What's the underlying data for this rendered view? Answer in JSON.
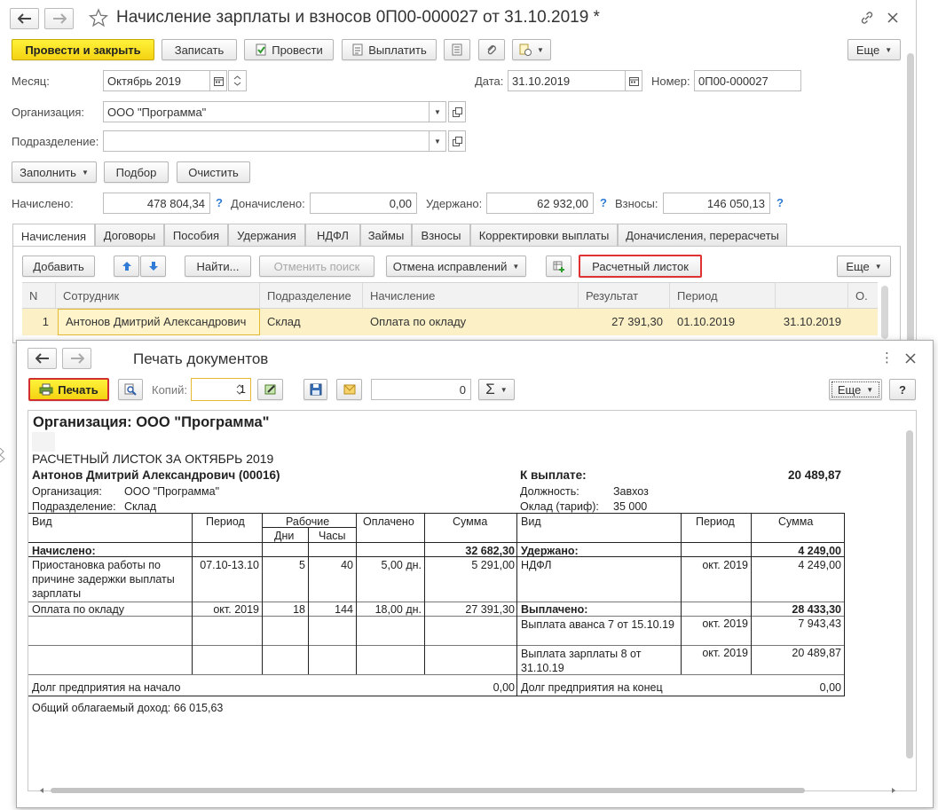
{
  "main": {
    "title": "Начисление зарплаты и взносов 0П00-000027 от 31.10.2019 *",
    "toolbar": {
      "post_close": "Провести и закрыть",
      "save": "Записать",
      "post": "Провести",
      "pay": "Выплатить",
      "more": "Еще"
    },
    "fields": {
      "month_label": "Месяц:",
      "month_value": "Октябрь 2019",
      "date_label": "Дата:",
      "date_value": "31.10.2019",
      "number_label": "Номер:",
      "number_value": "0П00-000027",
      "org_label": "Организация:",
      "org_value": "ООО \"Программа\"",
      "dept_label": "Подразделение:",
      "dept_value": ""
    },
    "actions": {
      "fill": "Заполнить",
      "select": "Подбор",
      "clear": "Очистить"
    },
    "totals": {
      "accrued_label": "Начислено:",
      "accrued_value": "478 804,34",
      "extra_label": "Доначислено:",
      "extra_value": "0,00",
      "withheld_label": "Удержано:",
      "withheld_value": "62 932,00",
      "contrib_label": "Взносы:",
      "contrib_value": "146 050,13",
      "help": "?"
    },
    "tabs": [
      "Начисления",
      "Договоры",
      "Пособия",
      "Удержания",
      "НДФЛ",
      "Займы",
      "Взносы",
      "Корректировки выплаты",
      "Доначисления, перерасчеты"
    ],
    "grid_toolbar": {
      "add": "Добавить",
      "find": "Найти...",
      "cancel_search": "Отменить поиск",
      "cancel_corrections": "Отмена исправлений",
      "payslip": "Расчетный листок",
      "more": "Еще"
    },
    "grid": {
      "columns": [
        "N",
        "Сотрудник",
        "Подразделение",
        "Начисление",
        "Результат",
        "Период",
        "",
        "О."
      ],
      "rows": [
        {
          "n": "1",
          "employee": "Антонов Дмитрий Александрович",
          "dept": "Склад",
          "accrual": "Оплата по окладу",
          "result": "27 391,30",
          "period_from": "01.10.2019",
          "period_to": "31.10.2019"
        }
      ]
    }
  },
  "print": {
    "title": "Печать документов",
    "print_btn": "Печать",
    "copies_label": "Копий:",
    "copies_value": "1",
    "sum_value": "0",
    "sigma": "Σ",
    "more": "Еще",
    "help": "?",
    "doc": {
      "org_header": "Организация: ООО \"Программа\"",
      "payslip_title": "РАСЧЕТНЫЙ ЛИСТОК ЗА ОКТЯБРЬ 2019",
      "employee": "Антонов Дмитрий Александрович (00016)",
      "org_label": "Организация:",
      "org_value": "ООО \"Программа\"",
      "dept_label": "Подразделение:",
      "dept_value": "Склад",
      "to_pay_label": "К выплате:",
      "to_pay_value": "20 489,87",
      "position_label": "Должность:",
      "position_value": "Завхоз",
      "salary_label": "Оклад (тариф):",
      "salary_value": "35 000",
      "left_headers": {
        "kind": "Вид",
        "period": "Период",
        "work": "Рабочие",
        "days": "Дни",
        "hours": "Часы",
        "paid": "Оплачено",
        "sum": "Сумма"
      },
      "right_headers": {
        "kind": "Вид",
        "period": "Период",
        "sum": "Сумма"
      },
      "accrued_label": "Начислено:",
      "accrued_total": "32 682,30",
      "withheld_label": "Удержано:",
      "withheld_total": "4 249,00",
      "left_rows": [
        {
          "kind": "Приостановка работы по причине задержки выплаты зарплаты",
          "period": "07.10-13.10",
          "days": "5",
          "hours": "40",
          "paid": "5,00 дн.",
          "sum": "5 291,00"
        },
        {
          "kind": "Оплата по окладу",
          "period": "окт. 2019",
          "days": "18",
          "hours": "144",
          "paid": "18,00 дн.",
          "sum": "27 391,30"
        }
      ],
      "right_rows": [
        {
          "kind": "НДФЛ",
          "period": "окт. 2019",
          "sum": "4 249,00"
        }
      ],
      "paid_label": "Выплачено:",
      "paid_total": "28 433,30",
      "paid_rows": [
        {
          "kind": "Выплата аванса 7 от 15.10.19",
          "period": "окт. 2019",
          "sum": "7 943,43"
        },
        {
          "kind": "Выплата зарплаты 8 от 31.10.19",
          "period": "окт. 2019",
          "sum": "20 489,87"
        }
      ],
      "debt_start_label": "Долг предприятия на начало",
      "debt_start_value": "0,00",
      "debt_end_label": "Долг предприятия на конец",
      "debt_end_value": "0,00",
      "taxable_income": "Общий облагаемый доход: 66 015,63"
    }
  }
}
